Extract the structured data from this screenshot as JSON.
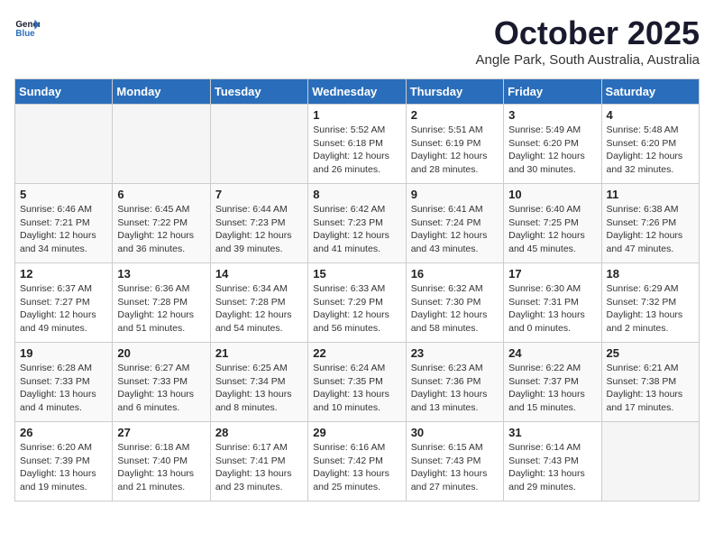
{
  "logo": {
    "line1": "General",
    "line2": "Blue"
  },
  "title": "October 2025",
  "location": "Angle Park, South Australia, Australia",
  "days_header": [
    "Sunday",
    "Monday",
    "Tuesday",
    "Wednesday",
    "Thursday",
    "Friday",
    "Saturday"
  ],
  "weeks": [
    [
      {
        "num": "",
        "info": ""
      },
      {
        "num": "",
        "info": ""
      },
      {
        "num": "",
        "info": ""
      },
      {
        "num": "1",
        "info": "Sunrise: 5:52 AM\nSunset: 6:18 PM\nDaylight: 12 hours\nand 26 minutes."
      },
      {
        "num": "2",
        "info": "Sunrise: 5:51 AM\nSunset: 6:19 PM\nDaylight: 12 hours\nand 28 minutes."
      },
      {
        "num": "3",
        "info": "Sunrise: 5:49 AM\nSunset: 6:20 PM\nDaylight: 12 hours\nand 30 minutes."
      },
      {
        "num": "4",
        "info": "Sunrise: 5:48 AM\nSunset: 6:20 PM\nDaylight: 12 hours\nand 32 minutes."
      }
    ],
    [
      {
        "num": "5",
        "info": "Sunrise: 6:46 AM\nSunset: 7:21 PM\nDaylight: 12 hours\nand 34 minutes."
      },
      {
        "num": "6",
        "info": "Sunrise: 6:45 AM\nSunset: 7:22 PM\nDaylight: 12 hours\nand 36 minutes."
      },
      {
        "num": "7",
        "info": "Sunrise: 6:44 AM\nSunset: 7:23 PM\nDaylight: 12 hours\nand 39 minutes."
      },
      {
        "num": "8",
        "info": "Sunrise: 6:42 AM\nSunset: 7:23 PM\nDaylight: 12 hours\nand 41 minutes."
      },
      {
        "num": "9",
        "info": "Sunrise: 6:41 AM\nSunset: 7:24 PM\nDaylight: 12 hours\nand 43 minutes."
      },
      {
        "num": "10",
        "info": "Sunrise: 6:40 AM\nSunset: 7:25 PM\nDaylight: 12 hours\nand 45 minutes."
      },
      {
        "num": "11",
        "info": "Sunrise: 6:38 AM\nSunset: 7:26 PM\nDaylight: 12 hours\nand 47 minutes."
      }
    ],
    [
      {
        "num": "12",
        "info": "Sunrise: 6:37 AM\nSunset: 7:27 PM\nDaylight: 12 hours\nand 49 minutes."
      },
      {
        "num": "13",
        "info": "Sunrise: 6:36 AM\nSunset: 7:28 PM\nDaylight: 12 hours\nand 51 minutes."
      },
      {
        "num": "14",
        "info": "Sunrise: 6:34 AM\nSunset: 7:28 PM\nDaylight: 12 hours\nand 54 minutes."
      },
      {
        "num": "15",
        "info": "Sunrise: 6:33 AM\nSunset: 7:29 PM\nDaylight: 12 hours\nand 56 minutes."
      },
      {
        "num": "16",
        "info": "Sunrise: 6:32 AM\nSunset: 7:30 PM\nDaylight: 12 hours\nand 58 minutes."
      },
      {
        "num": "17",
        "info": "Sunrise: 6:30 AM\nSunset: 7:31 PM\nDaylight: 13 hours\nand 0 minutes."
      },
      {
        "num": "18",
        "info": "Sunrise: 6:29 AM\nSunset: 7:32 PM\nDaylight: 13 hours\nand 2 minutes."
      }
    ],
    [
      {
        "num": "19",
        "info": "Sunrise: 6:28 AM\nSunset: 7:33 PM\nDaylight: 13 hours\nand 4 minutes."
      },
      {
        "num": "20",
        "info": "Sunrise: 6:27 AM\nSunset: 7:33 PM\nDaylight: 13 hours\nand 6 minutes."
      },
      {
        "num": "21",
        "info": "Sunrise: 6:25 AM\nSunset: 7:34 PM\nDaylight: 13 hours\nand 8 minutes."
      },
      {
        "num": "22",
        "info": "Sunrise: 6:24 AM\nSunset: 7:35 PM\nDaylight: 13 hours\nand 10 minutes."
      },
      {
        "num": "23",
        "info": "Sunrise: 6:23 AM\nSunset: 7:36 PM\nDaylight: 13 hours\nand 13 minutes."
      },
      {
        "num": "24",
        "info": "Sunrise: 6:22 AM\nSunset: 7:37 PM\nDaylight: 13 hours\nand 15 minutes."
      },
      {
        "num": "25",
        "info": "Sunrise: 6:21 AM\nSunset: 7:38 PM\nDaylight: 13 hours\nand 17 minutes."
      }
    ],
    [
      {
        "num": "26",
        "info": "Sunrise: 6:20 AM\nSunset: 7:39 PM\nDaylight: 13 hours\nand 19 minutes."
      },
      {
        "num": "27",
        "info": "Sunrise: 6:18 AM\nSunset: 7:40 PM\nDaylight: 13 hours\nand 21 minutes."
      },
      {
        "num": "28",
        "info": "Sunrise: 6:17 AM\nSunset: 7:41 PM\nDaylight: 13 hours\nand 23 minutes."
      },
      {
        "num": "29",
        "info": "Sunrise: 6:16 AM\nSunset: 7:42 PM\nDaylight: 13 hours\nand 25 minutes."
      },
      {
        "num": "30",
        "info": "Sunrise: 6:15 AM\nSunset: 7:43 PM\nDaylight: 13 hours\nand 27 minutes."
      },
      {
        "num": "31",
        "info": "Sunrise: 6:14 AM\nSunset: 7:43 PM\nDaylight: 13 hours\nand 29 minutes."
      },
      {
        "num": "",
        "info": ""
      }
    ]
  ]
}
